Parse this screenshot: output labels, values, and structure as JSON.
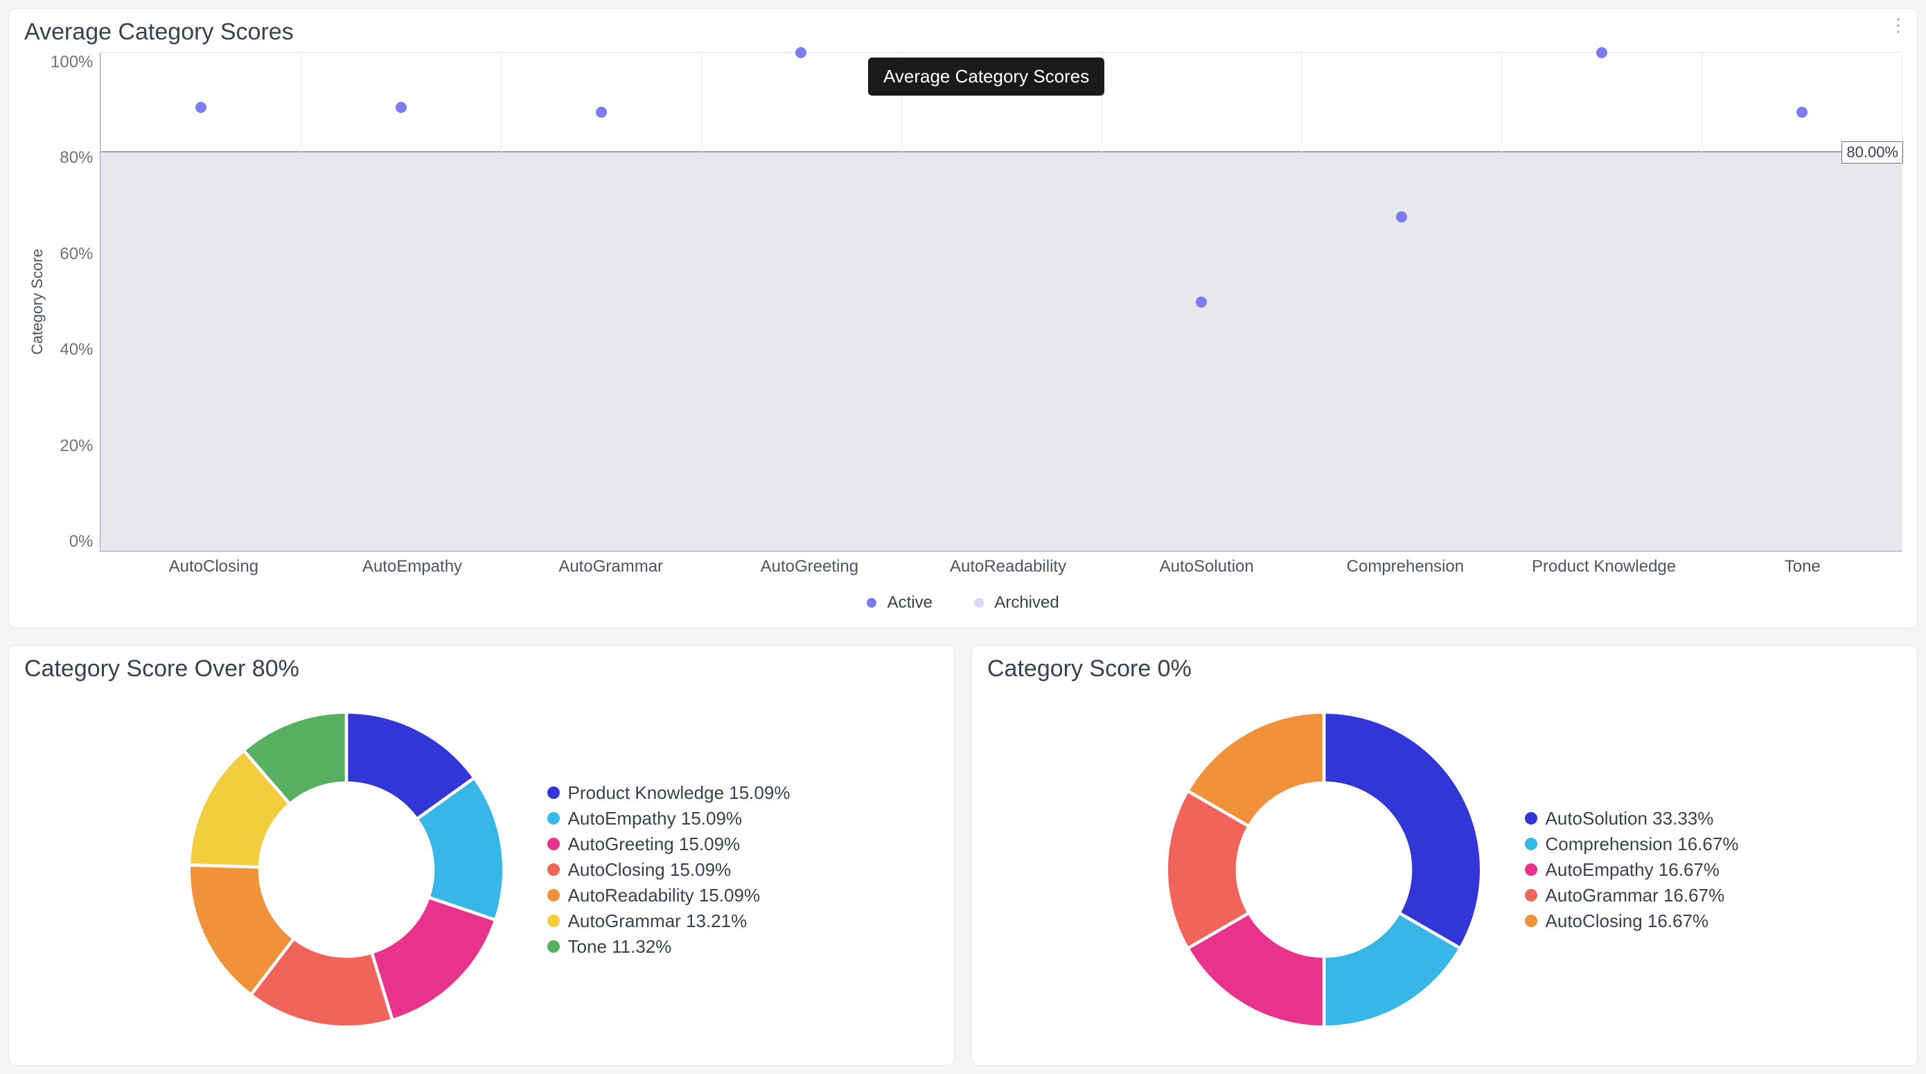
{
  "scatter": {
    "title": "Average Category Scores",
    "tooltip": "Average Category Scores",
    "ylabel": "Category Score",
    "yticks": [
      "100%",
      "80%",
      "60%",
      "40%",
      "20%",
      "0%"
    ],
    "ref_label": "80.00%",
    "legend": {
      "active": "Active",
      "archived": "Archived"
    }
  },
  "donut1": {
    "title": "Category Score Over 80%"
  },
  "donut2": {
    "title": "Category Score 0%"
  },
  "chart_data": [
    {
      "type": "scatter",
      "title": "Average Category Scores",
      "ylabel": "Category Score",
      "ylim": [
        0,
        100
      ],
      "reference_line": 80,
      "series": [
        {
          "name": "Active",
          "color": "#7b7cf0",
          "points": [
            {
              "x": "AutoClosing",
              "y": 89
            },
            {
              "x": "AutoEmpathy",
              "y": 89
            },
            {
              "x": "AutoGrammar",
              "y": 88
            },
            {
              "x": "AutoGreeting",
              "y": 100
            },
            {
              "x": "AutoReadability",
              "y": null
            },
            {
              "x": "AutoSolution",
              "y": 50
            },
            {
              "x": "Comprehension",
              "y": 67
            },
            {
              "x": "Product Knowledge",
              "y": 100
            },
            {
              "x": "Tone",
              "y": 88
            }
          ]
        },
        {
          "name": "Archived",
          "color": "#d8d9f8",
          "points": []
        }
      ],
      "categories": [
        "AutoClosing",
        "AutoEmpathy",
        "AutoGrammar",
        "AutoGreeting",
        "AutoReadability",
        "AutoSolution",
        "Comprehension",
        "Product Knowledge",
        "Tone"
      ]
    },
    {
      "type": "pie",
      "title": "Category Score Over 80%",
      "slices": [
        {
          "label": "Product Knowledge",
          "value": 15.09,
          "color": "#3236d6"
        },
        {
          "label": "AutoEmpathy",
          "value": 15.09,
          "color": "#36b7e7"
        },
        {
          "label": "AutoGreeting",
          "value": 15.09,
          "color": "#e8328b"
        },
        {
          "label": "AutoClosing",
          "value": 15.09,
          "color": "#f0645a"
        },
        {
          "label": "AutoReadability",
          "value": 15.09,
          "color": "#f1923a"
        },
        {
          "label": "AutoGrammar",
          "value": 13.21,
          "color": "#f2cd3e"
        },
        {
          "label": "Tone",
          "value": 11.32,
          "color": "#57b060"
        }
      ]
    },
    {
      "type": "pie",
      "title": "Category Score 0%",
      "slices": [
        {
          "label": "AutoSolution",
          "value": 33.33,
          "color": "#3236d6"
        },
        {
          "label": "Comprehension",
          "value": 16.67,
          "color": "#36b7e7"
        },
        {
          "label": "AutoEmpathy",
          "value": 16.67,
          "color": "#e8328b"
        },
        {
          "label": "AutoGrammar",
          "value": 16.67,
          "color": "#f0645a"
        },
        {
          "label": "AutoClosing",
          "value": 16.67,
          "color": "#f1923a"
        }
      ]
    }
  ]
}
